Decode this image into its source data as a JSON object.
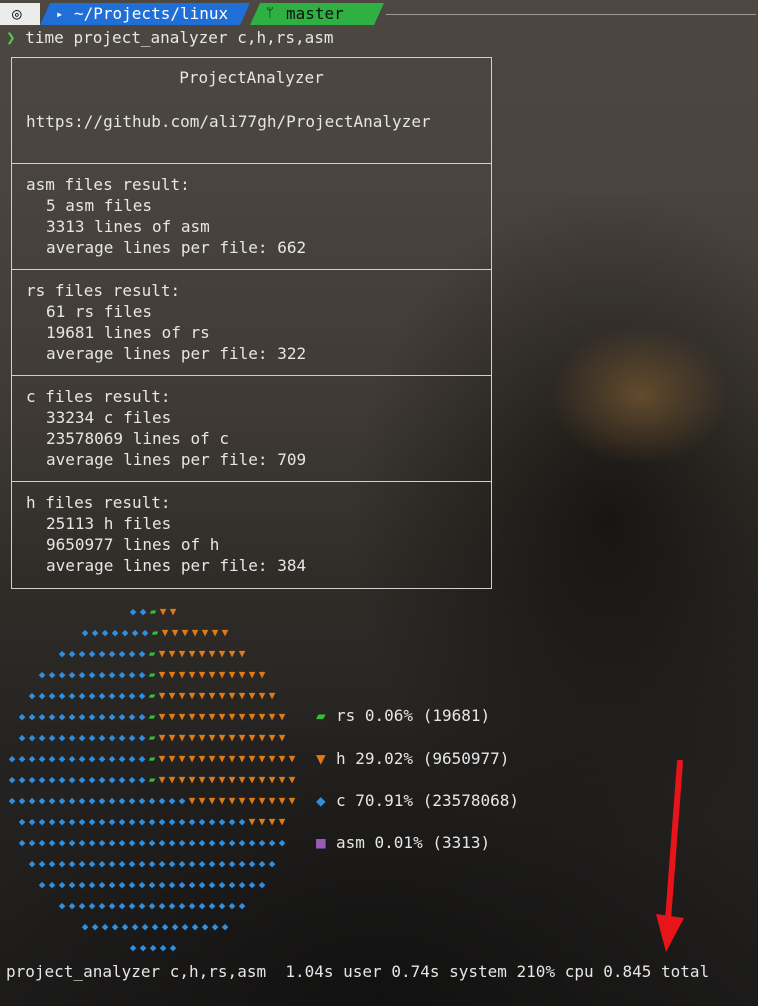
{
  "prompt": {
    "os_icon": "debian-icon",
    "os_glyph": "◎",
    "folder_glyph": "▸",
    "directory": "~/Projects/linux",
    "git_glyph": "ᛘ",
    "branch": "master"
  },
  "command": {
    "arrow": "❯",
    "text": "time project_analyzer c,h,rs,asm"
  },
  "report": {
    "title": "ProjectAnalyzer",
    "url": "https://github.com/ali77gh/ProjectAnalyzer",
    "sections": [
      {
        "header": "asm files result:",
        "files": "5 asm files",
        "lines": "3313 lines of asm",
        "avg": "average lines per file: 662"
      },
      {
        "header": "rs files result:",
        "files": "61 rs files",
        "lines": "19681 lines of rs",
        "avg": "average lines per file: 322"
      },
      {
        "header": "c files result:",
        "files": "33234 c files",
        "lines": "23578069 lines of c",
        "avg": "average lines per file: 709"
      },
      {
        "header": "h files result:",
        "files": "25113 h files",
        "lines": "9650977 lines of h",
        "avg": "average lines per file: 384"
      }
    ]
  },
  "chart_data": {
    "type": "waffle",
    "series": [
      {
        "name": "rs",
        "percent": 0.06,
        "lines": 19681,
        "color": "#32c23a",
        "symbol": "▰"
      },
      {
        "name": "h",
        "percent": 29.02,
        "lines": 9650977,
        "color": "#e07a16",
        "symbol": "▼"
      },
      {
        "name": "c",
        "percent": 70.91,
        "lines": 23578068,
        "color": "#2f8fe0",
        "symbol": "◆"
      },
      {
        "name": "asm",
        "percent": 0.01,
        "lines": 3313,
        "color": "#9b59b6",
        "symbol": "■"
      }
    ]
  },
  "legend": [
    {
      "symbol": "▰",
      "text": "rs 0.06% (19681)",
      "color": "#32c23a"
    },
    {
      "symbol": "▼",
      "text": "h 29.02% (9650977)",
      "color": "#e07a16"
    },
    {
      "symbol": "◆",
      "text": "c 70.91% (23578068)",
      "color": "#2f8fe0"
    },
    {
      "symbol": "■",
      "text": "asm 0.01% (3313)",
      "color": "#9b59b6"
    }
  ],
  "timing": "project_analyzer c,h,rs,asm  1.04s user 0.74s system 210% cpu 0.845 total",
  "colors": {
    "annotation_arrow": "#e8141a",
    "box_border": "#d0d0d0",
    "prompt_dir_bg": "#1f6fd6",
    "prompt_git_bg": "#2fb043"
  }
}
